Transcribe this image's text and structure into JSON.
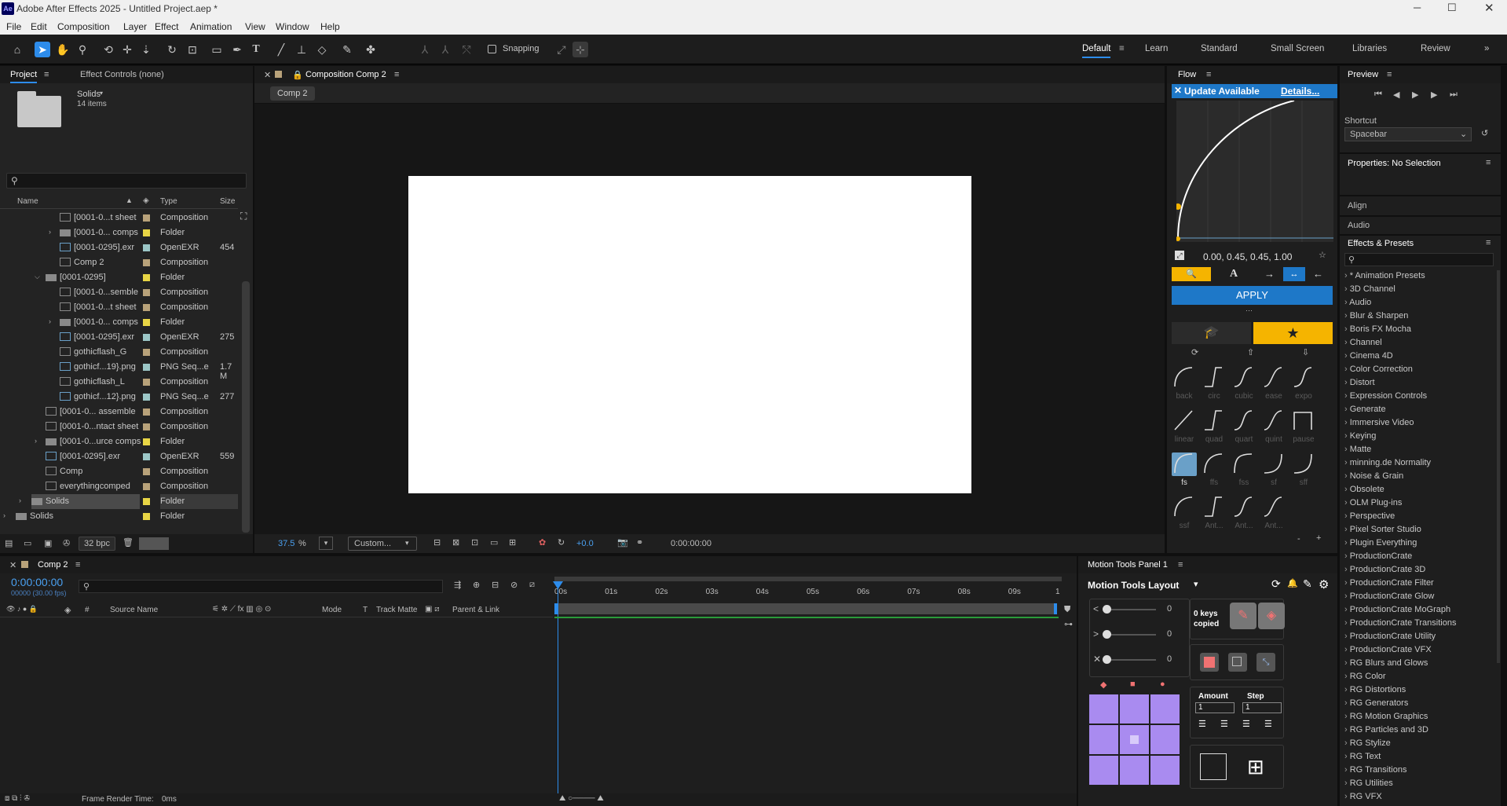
{
  "app": {
    "title": "Adobe After Effects 2025 - Untitled Project.aep *",
    "logo": "Ae"
  },
  "menu": [
    "File",
    "Edit",
    "Composition",
    "Layer",
    "Effect",
    "Animation",
    "View",
    "Window",
    "Help"
  ],
  "toolbar": {
    "snapping": "Snapping"
  },
  "workspaces": [
    "Default",
    "Learn",
    "Standard",
    "Small Screen",
    "Libraries",
    "Review"
  ],
  "project": {
    "tab": "Project",
    "effect_controls": "Effect Controls (none)",
    "folder_name": "Solids",
    "folder_count": "14 items",
    "columns": {
      "name": "Name",
      "type": "Type",
      "size": "Size"
    },
    "bpc": "32 bpc",
    "rows": [
      {
        "name": "[0001-0...t sheet",
        "type": "Composition",
        "size": "",
        "indent": 1,
        "kind": "comp",
        "color": "#b8a27a",
        "expand": ""
      },
      {
        "name": "[0001-0... comps",
        "type": "Folder",
        "size": "",
        "indent": 1,
        "kind": "folder",
        "color": "#e8d545",
        "expand": ">"
      },
      {
        "name": "[0001-0295].exr",
        "type": "OpenEXR",
        "size": "454",
        "indent": 1,
        "kind": "footage",
        "color": "#9cc7c7",
        "expand": ""
      },
      {
        "name": "Comp 2",
        "type": "Composition",
        "size": "",
        "indent": 1,
        "kind": "comp",
        "color": "#b8a27a",
        "expand": ""
      },
      {
        "name": "[0001-0295]",
        "type": "Folder",
        "size": "",
        "indent": 0,
        "kind": "folder",
        "color": "#e8d545",
        "expand": "v"
      },
      {
        "name": "[0001-0...semble",
        "type": "Composition",
        "size": "",
        "indent": 1,
        "kind": "comp",
        "color": "#b8a27a",
        "expand": ""
      },
      {
        "name": "[0001-0...t sheet",
        "type": "Composition",
        "size": "",
        "indent": 1,
        "kind": "comp",
        "color": "#b8a27a",
        "expand": ""
      },
      {
        "name": "[0001-0... comps",
        "type": "Folder",
        "size": "",
        "indent": 1,
        "kind": "folder",
        "color": "#e8d545",
        "expand": ">"
      },
      {
        "name": "[0001-0295].exr",
        "type": "OpenEXR",
        "size": "275",
        "indent": 1,
        "kind": "footage",
        "color": "#9cc7c7",
        "expand": ""
      },
      {
        "name": "gothicflash_G",
        "type": "Composition",
        "size": "",
        "indent": 1,
        "kind": "comp",
        "color": "#b8a27a",
        "expand": ""
      },
      {
        "name": "gothicf...19}.png",
        "type": "PNG Seq...e",
        "size": "1.7 M",
        "indent": 1,
        "kind": "footage",
        "color": "#9cc7c7",
        "expand": ""
      },
      {
        "name": "gothicflash_L",
        "type": "Composition",
        "size": "",
        "indent": 1,
        "kind": "comp",
        "color": "#b8a27a",
        "expand": ""
      },
      {
        "name": "gothicf...12}.png",
        "type": "PNG Seq...e",
        "size": "277",
        "indent": 1,
        "kind": "footage",
        "color": "#9cc7c7",
        "expand": ""
      },
      {
        "name": "[0001-0... assemble",
        "type": "Composition",
        "size": "",
        "indent": 0,
        "kind": "comp",
        "color": "#b8a27a",
        "expand": ""
      },
      {
        "name": "[0001-0...ntact sheet",
        "type": "Composition",
        "size": "",
        "indent": 0,
        "kind": "comp",
        "color": "#b8a27a",
        "expand": ""
      },
      {
        "name": "[0001-0...urce comps",
        "type": "Folder",
        "size": "",
        "indent": 0,
        "kind": "folder",
        "color": "#e8d545",
        "expand": ">"
      },
      {
        "name": "[0001-0295].exr",
        "type": "OpenEXR",
        "size": "559",
        "indent": 0,
        "kind": "footage",
        "color": "#9cc7c7",
        "expand": ""
      },
      {
        "name": "Comp",
        "type": "Composition",
        "size": "",
        "indent": 0,
        "kind": "comp",
        "color": "#b8a27a",
        "expand": ""
      },
      {
        "name": "everythingcomped",
        "type": "Composition",
        "size": "",
        "indent": 0,
        "kind": "comp",
        "color": "#b8a27a",
        "expand": ""
      },
      {
        "name": "Solids",
        "type": "Folder",
        "size": "",
        "indent": -1,
        "kind": "folder",
        "color": "#e8d545",
        "expand": ">",
        "selected": true
      },
      {
        "name": "Solids",
        "type": "Folder",
        "size": "",
        "indent": -2,
        "kind": "folder",
        "color": "#e8d545",
        "expand": ">"
      }
    ]
  },
  "composition": {
    "tab": "Composition Comp 2",
    "chip": "Comp 2",
    "zoom": "37.5",
    "zoom_unit": "%",
    "resolution": "Custom...",
    "exposure": "+0.0",
    "timecode": "0:00:00:00"
  },
  "flow": {
    "title": "Flow",
    "update": "Update Available",
    "details": "Details...",
    "values": "0.00, 0.45, 0.45, 1.00",
    "apply": "APPLY",
    "row1": [
      "back",
      "circ",
      "cubic",
      "ease",
      "expo"
    ],
    "row2": [
      "linear",
      "quad",
      "quart",
      "quint",
      "pause"
    ],
    "row3": [
      "fs",
      "ffs",
      "fss",
      "sf",
      "sff"
    ],
    "row4": [
      "ssf",
      "Ant...",
      "Ant...",
      "Ant..."
    ]
  },
  "preview": {
    "title": "Preview",
    "shortcut_label": "Shortcut",
    "shortcut_value": "Spacebar"
  },
  "properties": {
    "title": "Properties: No Selection"
  },
  "align": {
    "title": "Align"
  },
  "audio": {
    "title": "Audio"
  },
  "effects": {
    "title": "Effects & Presets",
    "items": [
      "* Animation Presets",
      "3D Channel",
      "Audio",
      "Blur & Sharpen",
      "Boris FX Mocha",
      "Channel",
      "Cinema 4D",
      "Color Correction",
      "Distort",
      "Expression Controls",
      "Generate",
      "Immersive Video",
      "Keying",
      "Matte",
      "minning.de Normality",
      "Noise & Grain",
      "Obsolete",
      "OLM Plug-ins",
      "Perspective",
      "Pixel Sorter Studio",
      "Plugin Everything",
      "ProductionCrate",
      "ProductionCrate 3D",
      "ProductionCrate Filter",
      "ProductionCrate Glow",
      "ProductionCrate MoGraph",
      "ProductionCrate Transitions",
      "ProductionCrate Utility",
      "ProductionCrate VFX",
      "RG Blurs and Glows",
      "RG Color",
      "RG Distortions",
      "RG Generators",
      "RG Motion Graphics",
      "RG Particles and 3D",
      "RG Stylize",
      "RG Text",
      "RG Transitions",
      "RG Utilities",
      "RG VFX"
    ]
  },
  "timeline": {
    "tab": "Comp 2",
    "timecode": "0:00:00:00",
    "fps": "00000 (30.00 fps)",
    "columns": {
      "hash": "#",
      "source": "Source Name",
      "mode": "Mode",
      "t": "T",
      "track": "Track Matte",
      "parent": "Parent & Link"
    },
    "ruler": [
      "00s",
      "01s",
      "02s",
      "03s",
      "04s",
      "05s",
      "06s",
      "07s",
      "08s",
      "09s",
      "1"
    ],
    "frame_render": "Frame Render Time:",
    "frame_render_value": "0ms"
  },
  "motion_tools": {
    "tab": "Motion Tools Panel 1",
    "layout": "Motion Tools Layout",
    "slider_values": [
      "0",
      "0",
      "0"
    ],
    "keys_copied": "0 keys copied",
    "amount_label": "Amount",
    "step_label": "Step",
    "amount_value": "1",
    "step_value": "1"
  },
  "colors": {
    "accent": "#2d8ceb",
    "flow_yellow": "#f5b400",
    "apply_blue": "#1e78c8",
    "mt_purple": "#a98bf0",
    "mt_red": "#f07272"
  }
}
